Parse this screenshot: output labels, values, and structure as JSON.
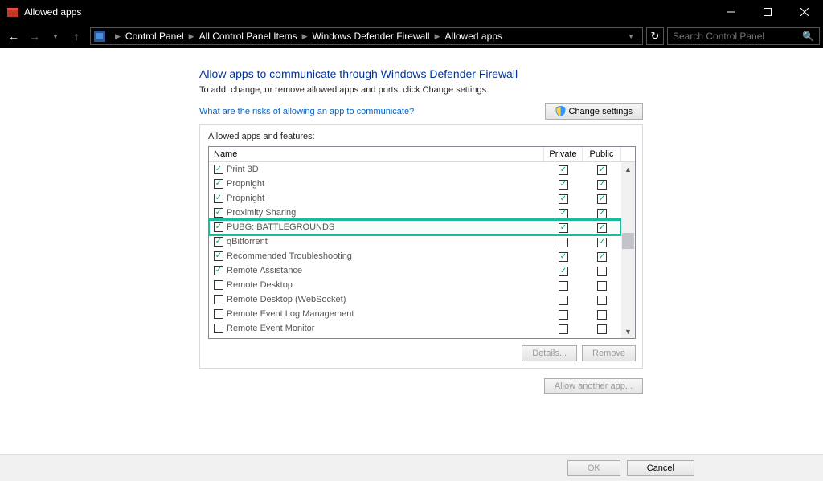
{
  "window": {
    "title": "Allowed apps"
  },
  "breadcrumb": {
    "items": [
      "Control Panel",
      "All Control Panel Items",
      "Windows Defender Firewall",
      "Allowed apps"
    ]
  },
  "search": {
    "placeholder": "Search Control Panel"
  },
  "page": {
    "heading": "Allow apps to communicate through Windows Defender Firewall",
    "sub": "To add, change, or remove allowed apps and ports, click Change settings.",
    "risks_link": "What are the risks of allowing an app to communicate?",
    "change_settings": "Change settings",
    "panel_title": "Allowed apps and features:",
    "headers": {
      "name": "Name",
      "private": "Private",
      "public": "Public"
    },
    "details": "Details...",
    "remove": "Remove",
    "allow_another": "Allow another app...",
    "ok": "OK",
    "cancel": "Cancel"
  },
  "apps": [
    {
      "name": "Print 3D",
      "name_checked": true,
      "private": true,
      "public": true,
      "hl": false
    },
    {
      "name": "Propnight",
      "name_checked": true,
      "private": true,
      "public": true,
      "hl": false
    },
    {
      "name": "Propnight",
      "name_checked": true,
      "private": true,
      "public": true,
      "hl": false
    },
    {
      "name": "Proximity Sharing",
      "name_checked": true,
      "private": true,
      "public": true,
      "hl": false
    },
    {
      "name": "PUBG: BATTLEGROUNDS",
      "name_checked": true,
      "private": true,
      "public": true,
      "hl": true
    },
    {
      "name": "qBittorrent",
      "name_checked": true,
      "private": false,
      "public": true,
      "hl": false
    },
    {
      "name": "Recommended Troubleshooting",
      "name_checked": true,
      "private": true,
      "public": true,
      "hl": false
    },
    {
      "name": "Remote Assistance",
      "name_checked": true,
      "private": true,
      "public": false,
      "hl": false
    },
    {
      "name": "Remote Desktop",
      "name_checked": false,
      "private": false,
      "public": false,
      "hl": false
    },
    {
      "name": "Remote Desktop (WebSocket)",
      "name_checked": false,
      "private": false,
      "public": false,
      "hl": false
    },
    {
      "name": "Remote Event Log Management",
      "name_checked": false,
      "private": false,
      "public": false,
      "hl": false
    },
    {
      "name": "Remote Event Monitor",
      "name_checked": false,
      "private": false,
      "public": false,
      "hl": false
    }
  ]
}
